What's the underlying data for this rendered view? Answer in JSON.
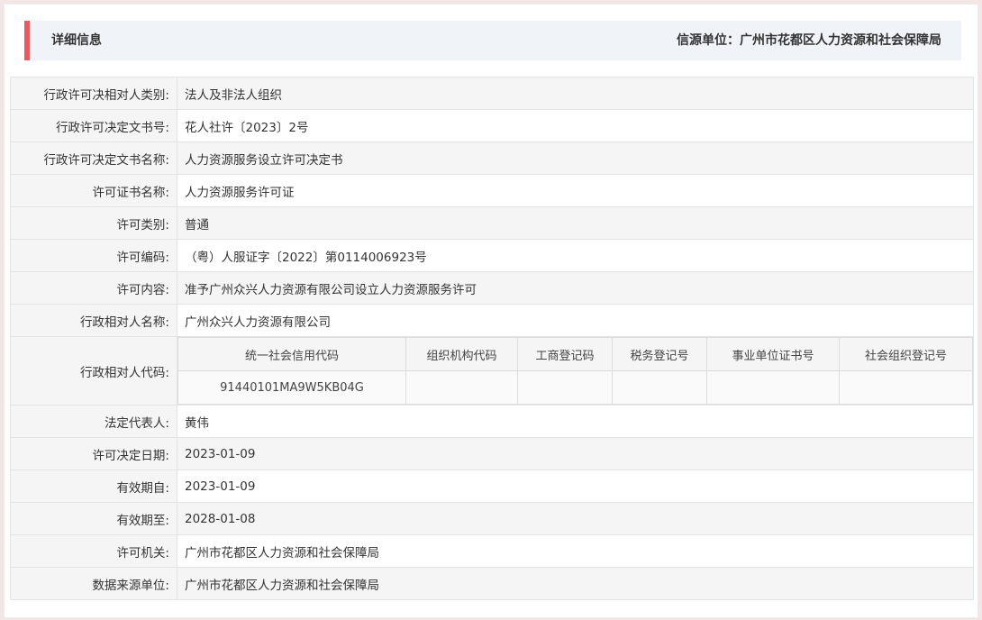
{
  "header": {
    "title": "详细信息",
    "source": "信源单位：广州市花都区人力资源和社会保障局"
  },
  "rows_top": [
    {
      "label": "行政许可决相对人类别:",
      "value": "法人及非法人组织"
    },
    {
      "label": "行政许可决定文书号:",
      "value": "花人社许〔2023〕2号"
    },
    {
      "label": "行政许可决定文书名称:",
      "value": "人力资源服务设立许可决定书"
    },
    {
      "label": "许可证书名称:",
      "value": "人力资源服务许可证"
    },
    {
      "label": "许可类别:",
      "value": "普通"
    },
    {
      "label": "许可编码:",
      "value": "（粤）人服证字〔2022〕第0114006923号"
    },
    {
      "label": "许可内容:",
      "value": "准予广州众兴人力资源有限公司设立人力资源服务许可"
    },
    {
      "label": "行政相对人名称:",
      "value": "广州众兴人力资源有限公司"
    }
  ],
  "codes": {
    "label": "行政相对人代码:",
    "headers": [
      "统一社会信用代码",
      "组织机构代码",
      "工商登记码",
      "税务登记号",
      "事业单位证书号",
      "社会组织登记号"
    ],
    "values": [
      "91440101MA9W5KB04G",
      "",
      "",
      "",
      "",
      ""
    ]
  },
  "rows_bottom": [
    {
      "label": "法定代表人:",
      "value": "黄伟"
    },
    {
      "label": "许可决定日期:",
      "value": "2023-01-09"
    },
    {
      "label": "有效期自:",
      "value": "2023-01-09"
    },
    {
      "label": "有效期至:",
      "value": "2028-01-08"
    },
    {
      "label": "许可机关:",
      "value": "广州市花都区人力资源和社会保障局"
    },
    {
      "label": "数据来源单位:",
      "value": "广州市花都区人力资源和社会保障局"
    }
  ]
}
